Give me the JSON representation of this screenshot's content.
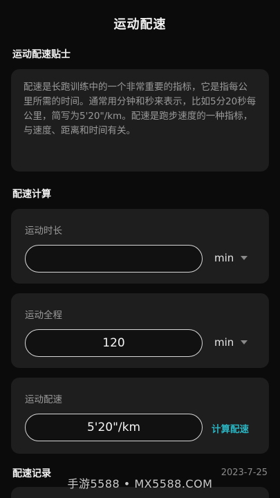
{
  "header": {
    "title": "运动配速"
  },
  "tips": {
    "section_title": "运动配速贴士",
    "text": "配速是长跑训练中的一个非常重要的指标，它是指每公里所需的时间。通常用分钟和秒来表示，比如5分20秒每公里，简写为5'20\"/km。配速是跑步速度的一种指标，与速度、距离和时间有关。"
  },
  "calc": {
    "section_title": "配速计算",
    "duration": {
      "label": "运动时长",
      "value": "",
      "unit": "min"
    },
    "distance": {
      "label": "运动全程",
      "value": "120",
      "unit": "min"
    },
    "pace": {
      "label": "运动配速",
      "value": "5'20\"/km",
      "button": "计算配速"
    }
  },
  "records": {
    "section_title": "配速记录",
    "date": "2023-7-25"
  },
  "watermark": "手游5588 • MX5588.COM",
  "colors": {
    "accent": "#2ab3c0",
    "card": "#1e1e1e",
    "background": "#0b0b0b"
  }
}
